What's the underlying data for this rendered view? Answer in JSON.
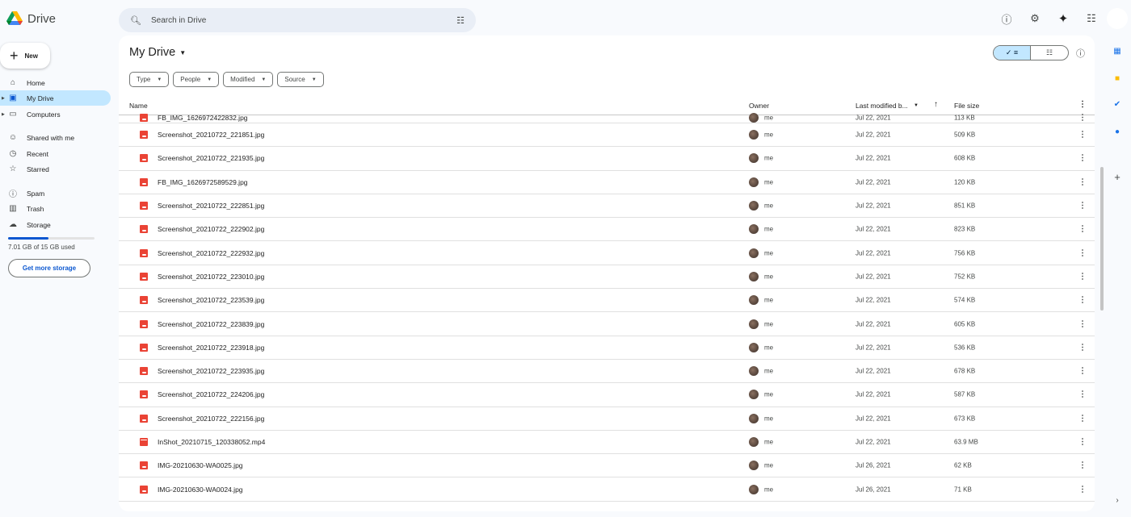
{
  "app": {
    "name": "Drive"
  },
  "search": {
    "placeholder": "Search in Drive"
  },
  "topbar": {
    "icons": [
      "help-icon",
      "settings-icon",
      "gemini-icon",
      "apps-icon"
    ]
  },
  "sidebar": {
    "new_label": "New",
    "items": [
      {
        "label": "Home",
        "icon": "home-icon"
      },
      {
        "label": "My Drive",
        "icon": "my-drive-icon",
        "active": true
      },
      {
        "label": "Computers",
        "icon": "computers-icon"
      },
      {
        "label": "Shared with me",
        "icon": "shared-icon"
      },
      {
        "label": "Recent",
        "icon": "clock-icon"
      },
      {
        "label": "Starred",
        "icon": "star-icon"
      },
      {
        "label": "Spam",
        "icon": "spam-icon"
      },
      {
        "label": "Trash",
        "icon": "trash-icon"
      },
      {
        "label": "Storage",
        "icon": "cloud-icon"
      }
    ],
    "storage": {
      "used_text": "7.01 GB of 15 GB used",
      "used_fraction": 0.467,
      "button": "Get more storage"
    }
  },
  "main": {
    "title": "My Drive",
    "filters": [
      "Type",
      "People",
      "Modified",
      "Source"
    ],
    "columns": {
      "name": "Name",
      "owner": "Owner",
      "modified": "Last modified b...",
      "size": "File size"
    },
    "files": [
      {
        "name": "FB_IMG_1626972422832.jpg",
        "type": "image",
        "owner": "me",
        "modified": "Jul 22, 2021",
        "size": "113 KB"
      },
      {
        "name": "Screenshot_20210722_221851.jpg",
        "type": "image",
        "owner": "me",
        "modified": "Jul 22, 2021",
        "size": "509 KB"
      },
      {
        "name": "Screenshot_20210722_221935.jpg",
        "type": "image",
        "owner": "me",
        "modified": "Jul 22, 2021",
        "size": "608 KB"
      },
      {
        "name": "FB_IMG_1626972589529.jpg",
        "type": "image",
        "owner": "me",
        "modified": "Jul 22, 2021",
        "size": "120 KB"
      },
      {
        "name": "Screenshot_20210722_222851.jpg",
        "type": "image",
        "owner": "me",
        "modified": "Jul 22, 2021",
        "size": "851 KB"
      },
      {
        "name": "Screenshot_20210722_222902.jpg",
        "type": "image",
        "owner": "me",
        "modified": "Jul 22, 2021",
        "size": "823 KB"
      },
      {
        "name": "Screenshot_20210722_222932.jpg",
        "type": "image",
        "owner": "me",
        "modified": "Jul 22, 2021",
        "size": "756 KB"
      },
      {
        "name": "Screenshot_20210722_223010.jpg",
        "type": "image",
        "owner": "me",
        "modified": "Jul 22, 2021",
        "size": "752 KB"
      },
      {
        "name": "Screenshot_20210722_223539.jpg",
        "type": "image",
        "owner": "me",
        "modified": "Jul 22, 2021",
        "size": "574 KB"
      },
      {
        "name": "Screenshot_20210722_223839.jpg",
        "type": "image",
        "owner": "me",
        "modified": "Jul 22, 2021",
        "size": "605 KB"
      },
      {
        "name": "Screenshot_20210722_223918.jpg",
        "type": "image",
        "owner": "me",
        "modified": "Jul 22, 2021",
        "size": "536 KB"
      },
      {
        "name": "Screenshot_20210722_223935.jpg",
        "type": "image",
        "owner": "me",
        "modified": "Jul 22, 2021",
        "size": "678 KB"
      },
      {
        "name": "Screenshot_20210722_224206.jpg",
        "type": "image",
        "owner": "me",
        "modified": "Jul 22, 2021",
        "size": "587 KB"
      },
      {
        "name": "Screenshot_20210722_222156.jpg",
        "type": "image",
        "owner": "me",
        "modified": "Jul 22, 2021",
        "size": "673 KB"
      },
      {
        "name": "InShot_20210715_120338052.mp4",
        "type": "video",
        "owner": "me",
        "modified": "Jul 22, 2021",
        "size": "63.9 MB"
      },
      {
        "name": "IMG-20210630-WA0025.jpg",
        "type": "image",
        "owner": "me",
        "modified": "Jul 26, 2021",
        "size": "62 KB"
      },
      {
        "name": "IMG-20210630-WA0024.jpg",
        "type": "image",
        "owner": "me",
        "modified": "Jul 26, 2021",
        "size": "71 KB"
      }
    ]
  },
  "colors": {
    "accent": "#0b57d0",
    "active_bg": "#c2e7ff",
    "file_icon": "#ea4335"
  }
}
